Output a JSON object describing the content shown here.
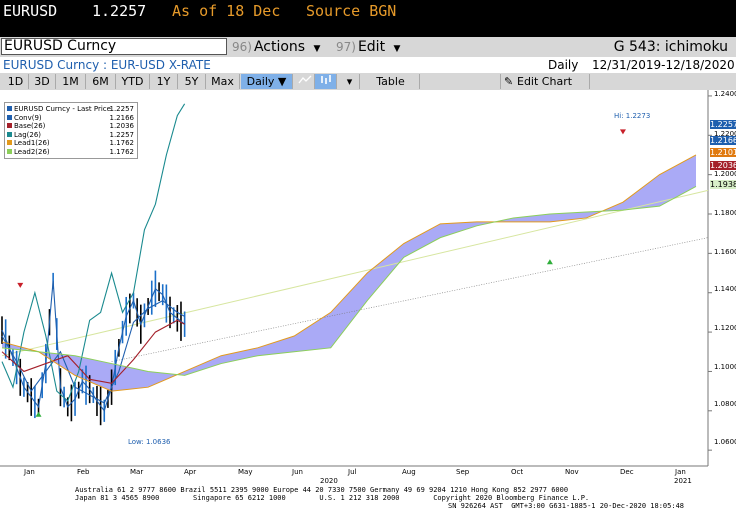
{
  "header": {
    "ticker": "EURUSD",
    "price": "1.2257",
    "as_of": "As of 18 Dec",
    "source": "Source BGN"
  },
  "command": {
    "security": "EURUSD Curncy",
    "actions_num": "96)",
    "actions_label": "Actions",
    "edit_num": "97)",
    "edit_label": "Edit",
    "function": "G 543: ichimoku"
  },
  "title": {
    "security_name": "EURUSD Curncy : EUR-USD X-RATE",
    "period": "Daily",
    "date_range": "12/31/2019-12/18/2020"
  },
  "toolbar": {
    "ranges": [
      "1D",
      "3D",
      "1M",
      "6M",
      "YTD",
      "1Y",
      "5Y",
      "Max"
    ],
    "frequency": "Daily ▼",
    "table_label": "Table",
    "edit_chart_label": "Edit Chart",
    "dropdown_glyph": "▾"
  },
  "legend": {
    "items": [
      {
        "label": "EURUSD Curncy - Last Price",
        "value": "1.2257",
        "color": "#1f5fae"
      },
      {
        "label": "Conv(9)",
        "value": "1.2166",
        "color": "#1f5fae"
      },
      {
        "label": "Base(26)",
        "value": "1.2036",
        "color": "#a4202a"
      },
      {
        "label": "Lag(26)",
        "value": "1.2257",
        "color": "#1a8a8f"
      },
      {
        "label": "Lead1(26)",
        "value": "1.1762",
        "color": "#e39a1c"
      },
      {
        "label": "Lead2(26)",
        "value": "1.1762",
        "color": "#8ccf5a"
      }
    ]
  },
  "chart_data": {
    "type": "line",
    "y_ticks": [
      "1.2400",
      "1.2200",
      "1.2000",
      "1.1800",
      "1.1600",
      "1.1400",
      "1.1200",
      "1.1000",
      "1.0800",
      "1.0600"
    ],
    "ylim": [
      1.055,
      1.242
    ],
    "x_ticks": [
      "Jan",
      "Feb",
      "Mar",
      "Apr",
      "May",
      "Jun",
      "Jul",
      "Aug",
      "Sep",
      "Oct",
      "Nov",
      "Dec",
      "Jan"
    ],
    "year_labels": [
      "2020",
      "2021"
    ],
    "high_label": "Hi: 1.2273",
    "low_label": "Low: 1.0636",
    "last_value_tags": [
      {
        "text": "1.2257",
        "value": 1.2257,
        "color": "#1f5fae"
      },
      {
        "text": "1.2166",
        "value": 1.2166,
        "color": "#1f5fae"
      },
      {
        "text": "1.2101",
        "value": 1.2101,
        "color": "#e07a10"
      },
      {
        "text": "1.2036",
        "value": 1.2036,
        "color": "#a4202a"
      },
      {
        "text": "1.1938",
        "value": 1.1938,
        "color": "#3aa142"
      }
    ],
    "series": [
      {
        "name": "EURUSD Curncy - Last Price",
        "color": "#1f5fae",
        "x": [
          0,
          2,
          4,
          6,
          8,
          10,
          12,
          14,
          16,
          18,
          20,
          22,
          24,
          26,
          28,
          30,
          32,
          34,
          36,
          38,
          40,
          42,
          44,
          46,
          48,
          50
        ],
        "values": [
          1.121,
          1.112,
          1.102,
          1.092,
          1.087,
          1.082,
          1.104,
          1.146,
          1.092,
          1.082,
          1.086,
          1.095,
          1.091,
          1.085,
          1.08,
          1.092,
          1.112,
          1.128,
          1.136,
          1.124,
          1.133,
          1.142,
          1.139,
          1.13,
          1.127,
          1.124
        ]
      },
      {
        "name": "Conv(9)",
        "color": "#1f5fae",
        "x": [
          0,
          4,
          8,
          12,
          16,
          20,
          24,
          28,
          32,
          36,
          40,
          44,
          48,
          50
        ],
        "values": [
          1.118,
          1.105,
          1.09,
          1.1,
          1.11,
          1.092,
          1.088,
          1.084,
          1.1,
          1.125,
          1.132,
          1.136,
          1.13,
          1.128
        ]
      },
      {
        "name": "Base(26)",
        "color": "#a4202a",
        "x": [
          0,
          6,
          12,
          18,
          24,
          30,
          36,
          42,
          48,
          50
        ],
        "values": [
          1.11,
          1.1,
          1.104,
          1.108,
          1.096,
          1.094,
          1.106,
          1.12,
          1.126,
          1.124
        ]
      },
      {
        "name": "Lag(26)",
        "color": "#1a8a8f",
        "x": [
          0,
          3,
          6,
          9,
          12,
          15,
          18,
          21,
          24,
          27,
          30,
          33,
          36,
          39,
          42,
          45,
          48,
          50
        ],
        "values": [
          1.105,
          1.092,
          1.12,
          1.14,
          1.118,
          1.09,
          1.085,
          1.1,
          1.126,
          1.13,
          1.15,
          1.13,
          1.14,
          1.172,
          1.185,
          1.21,
          1.23,
          1.236
        ]
      },
      {
        "name": "Lead1(26)",
        "color": "#e39a1c",
        "x": [
          0,
          10,
          20,
          30,
          40,
          50,
          60,
          70,
          80,
          90,
          100,
          110,
          120,
          130,
          140,
          150,
          160,
          170,
          180,
          190
        ],
        "values": [
          1.115,
          1.11,
          1.098,
          1.09,
          1.092,
          1.1,
          1.108,
          1.112,
          1.118,
          1.13,
          1.15,
          1.165,
          1.175,
          1.176,
          1.176,
          1.176,
          1.178,
          1.186,
          1.2,
          1.21
        ]
      },
      {
        "name": "Lead2(26)",
        "color": "#8ccf5a",
        "x": [
          0,
          10,
          20,
          30,
          40,
          50,
          60,
          70,
          80,
          90,
          100,
          110,
          120,
          130,
          140,
          150,
          160,
          170,
          180,
          190
        ],
        "values": [
          1.112,
          1.11,
          1.108,
          1.104,
          1.1,
          1.098,
          1.104,
          1.108,
          1.11,
          1.112,
          1.136,
          1.158,
          1.168,
          1.174,
          1.178,
          1.18,
          1.181,
          1.182,
          1.184,
          1.194
        ]
      }
    ]
  },
  "footer": {
    "line1": "Australia 61 2 9777 8600 Brazil 5511 2395 9000 Europe 44 20 7330 7500 Germany 49 69 9204 1210 Hong Kong 852 2977 6000",
    "line2": "Japan 81 3 4565 8900        Singapore 65 6212 1000        U.S. 1 212 318 2000        Copyright 2020 Bloomberg Finance L.P.",
    "line3": "SN 926264 AST  GMT+3:00 G631-1885-1 20-Dec-2020 18:05:48"
  }
}
